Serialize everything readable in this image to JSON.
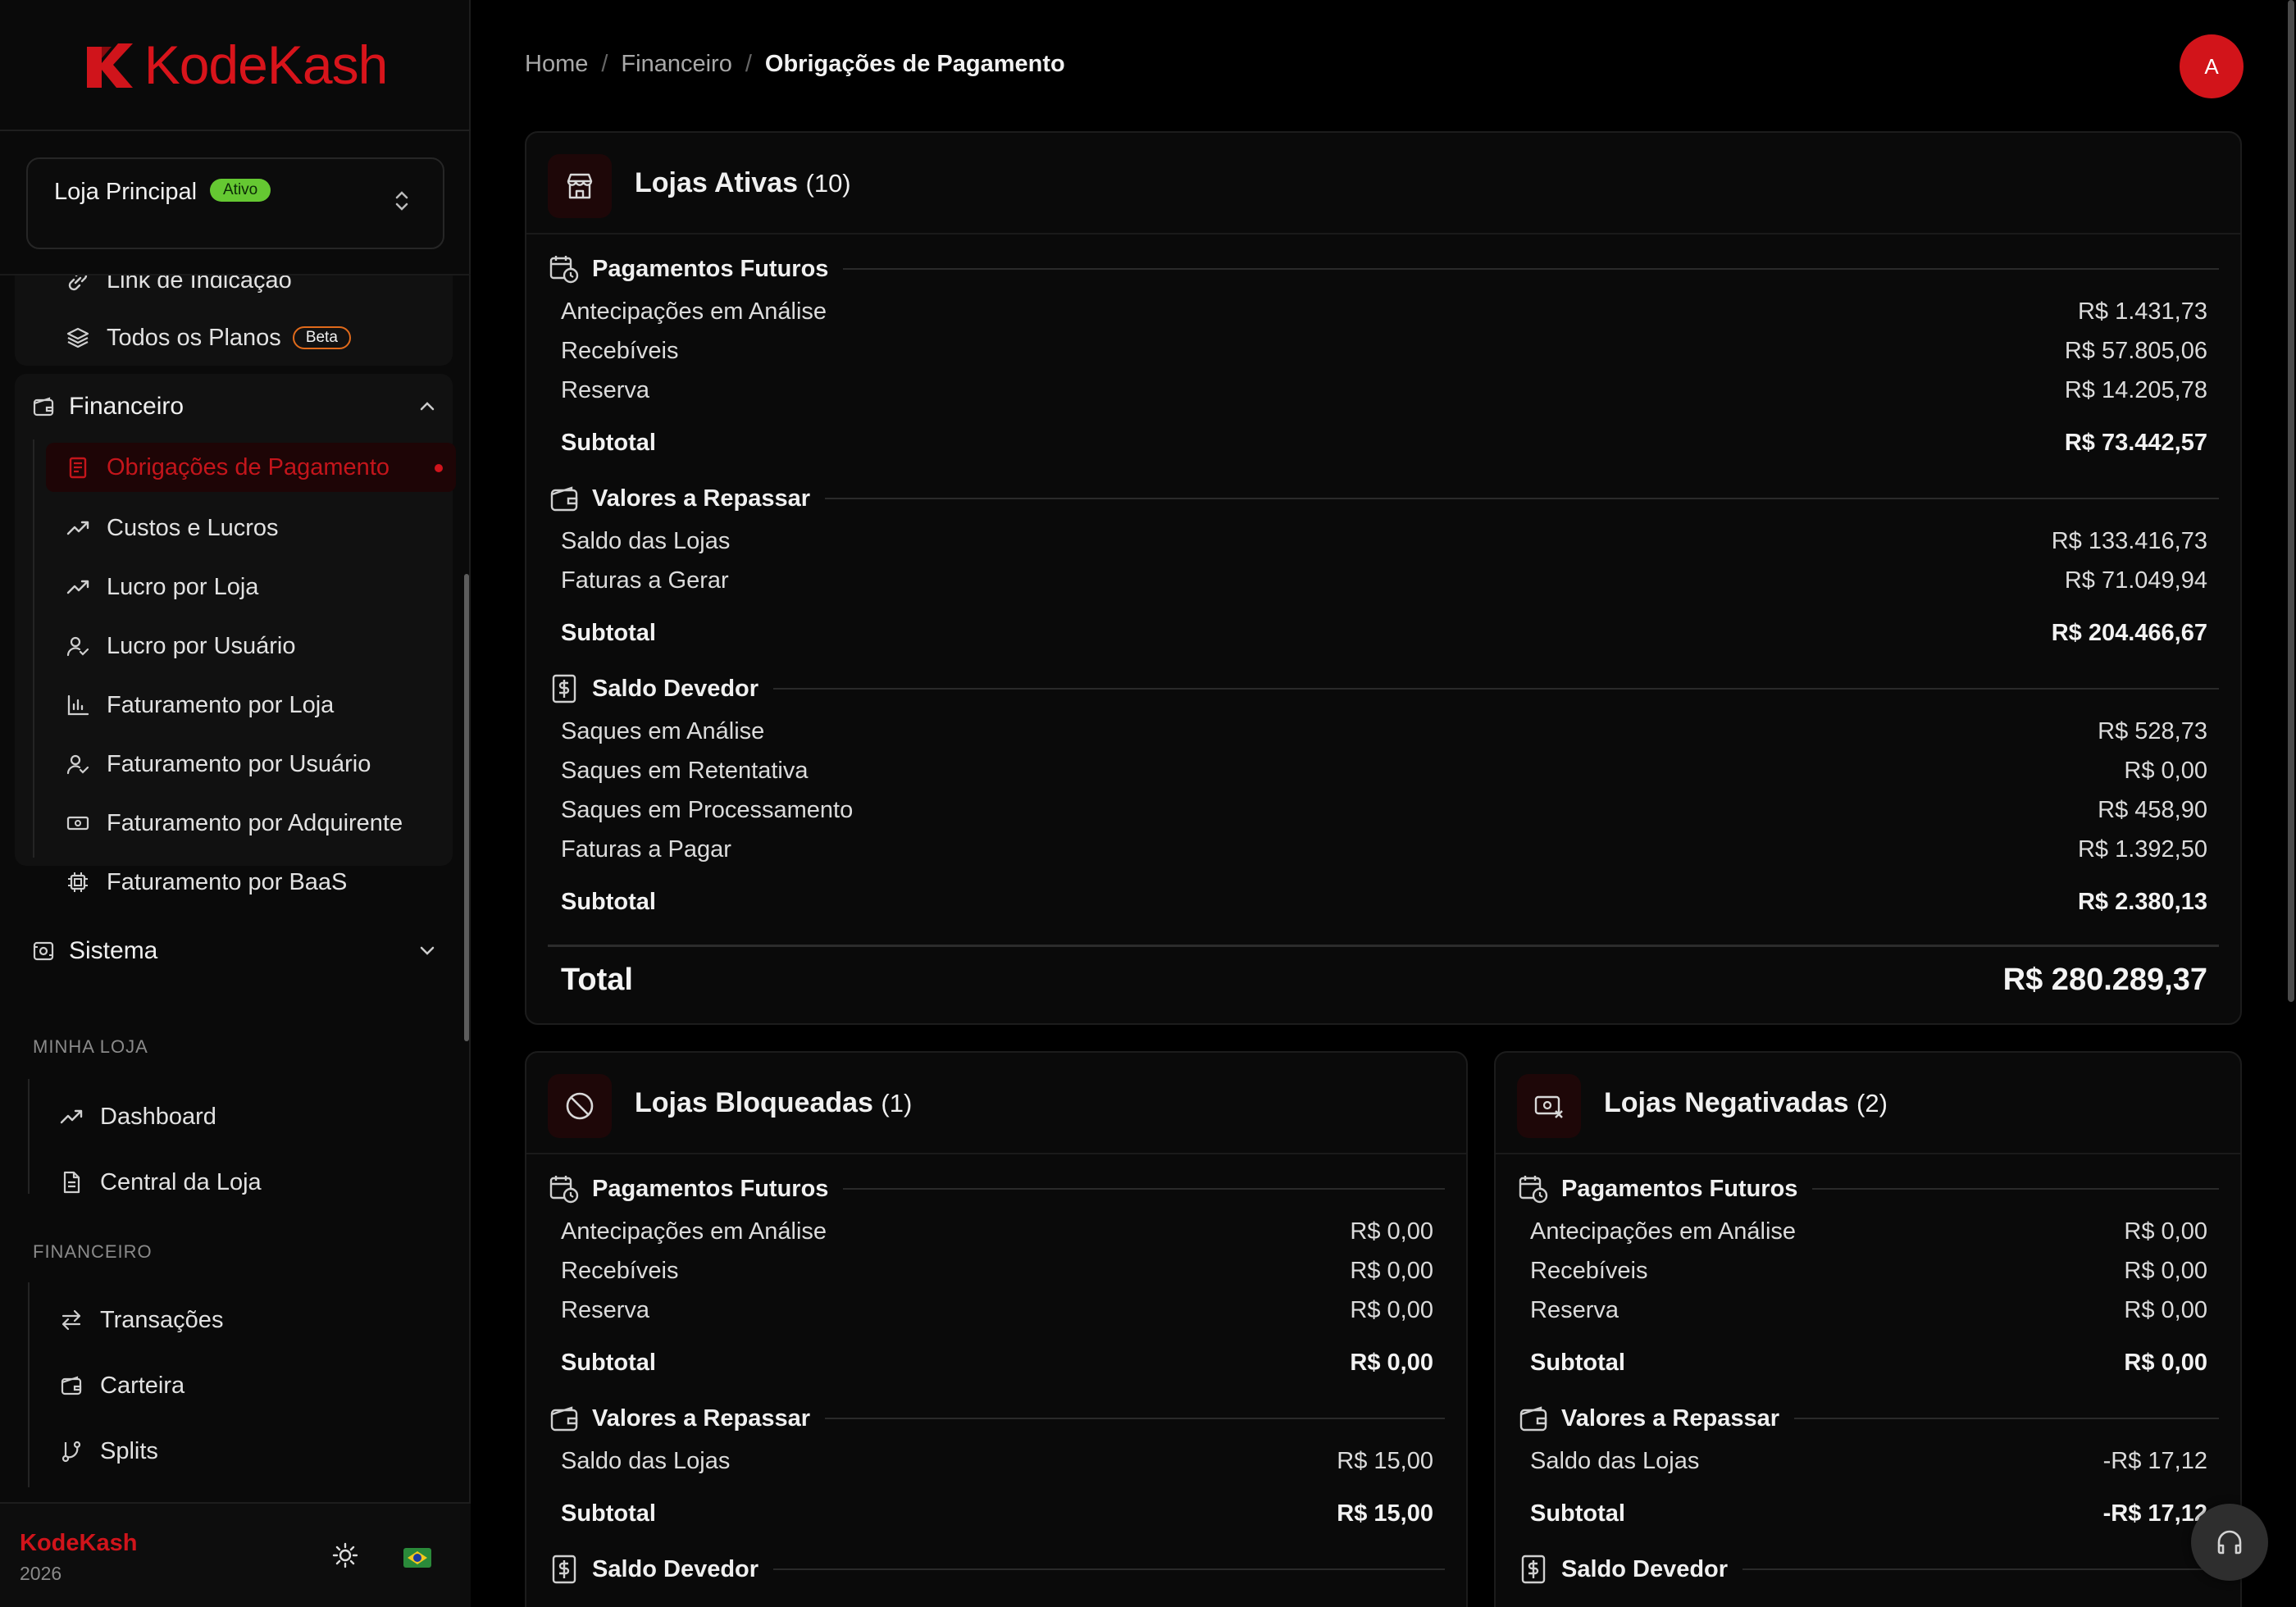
{
  "brand": {
    "name": "KodeKash",
    "year": "2026"
  },
  "store": {
    "name": "Loja Principal",
    "status": "Ativo"
  },
  "sidebar": {
    "top_items": [
      {
        "label": "Link de Indicação"
      },
      {
        "label": "Todos os Planos",
        "badge": "Beta"
      }
    ],
    "financeiro_group": {
      "label": "Financeiro",
      "items": [
        {
          "label": "Obrigações de Pagamento"
        },
        {
          "label": "Custos e Lucros"
        },
        {
          "label": "Lucro por Loja"
        },
        {
          "label": "Lucro por Usuário"
        },
        {
          "label": "Faturamento por Loja"
        },
        {
          "label": "Faturamento por Usuário"
        },
        {
          "label": "Faturamento por Adquirente"
        },
        {
          "label": "Faturamento por BaaS"
        }
      ]
    },
    "sistema_group": {
      "label": "Sistema"
    },
    "minha_loja": {
      "heading": "MINHA LOJA",
      "items": [
        {
          "label": "Dashboard"
        },
        {
          "label": "Central da Loja"
        }
      ]
    },
    "financeiro_section": {
      "heading": "FINANCEIRO",
      "items": [
        {
          "label": "Transações"
        },
        {
          "label": "Carteira"
        },
        {
          "label": "Splits"
        }
      ]
    }
  },
  "breadcrumb": {
    "home": "Home",
    "parent": "Financeiro",
    "current": "Obrigações de Pagamento"
  },
  "user": {
    "initial": "A"
  },
  "cards": {
    "ativas": {
      "title": "Lojas Ativas",
      "count": "(10)",
      "futuros": {
        "label": "Pagamentos Futuros",
        "rows": [
          {
            "label": "Antecipações em Análise",
            "value": "R$ 1.431,73"
          },
          {
            "label": "Recebíveis",
            "value": "R$ 57.805,06"
          },
          {
            "label": "Reserva",
            "value": "R$ 14.205,78"
          }
        ],
        "subtotal_label": "Subtotal",
        "subtotal": "R$ 73.442,57"
      },
      "repassar": {
        "label": "Valores a Repassar",
        "rows": [
          {
            "label": "Saldo das Lojas",
            "value": "R$ 133.416,73"
          },
          {
            "label": "Faturas a Gerar",
            "value": "R$ 71.049,94"
          }
        ],
        "subtotal_label": "Subtotal",
        "subtotal": "R$ 204.466,67"
      },
      "devedor": {
        "label": "Saldo Devedor",
        "rows": [
          {
            "label": "Saques em Análise",
            "value": "R$ 528,73"
          },
          {
            "label": "Saques em Retentativa",
            "value": "R$ 0,00"
          },
          {
            "label": "Saques em Processamento",
            "value": "R$ 458,90"
          },
          {
            "label": "Faturas a Pagar",
            "value": "R$ 1.392,50"
          }
        ],
        "subtotal_label": "Subtotal",
        "subtotal": "R$ 2.380,13"
      },
      "total_label": "Total",
      "total": "R$ 280.289,37"
    },
    "bloqueadas": {
      "title": "Lojas Bloqueadas",
      "count": "(1)",
      "futuros": {
        "label": "Pagamentos Futuros",
        "rows": [
          {
            "label": "Antecipações em Análise",
            "value": "R$ 0,00"
          },
          {
            "label": "Recebíveis",
            "value": "R$ 0,00"
          },
          {
            "label": "Reserva",
            "value": "R$ 0,00"
          }
        ],
        "subtotal_label": "Subtotal",
        "subtotal": "R$ 0,00"
      },
      "repassar": {
        "label": "Valores a Repassar",
        "rows": [
          {
            "label": "Saldo das Lojas",
            "value": "R$ 15,00"
          }
        ],
        "subtotal_label": "Subtotal",
        "subtotal": "R$ 15,00"
      },
      "devedor": {
        "label": "Saldo Devedor"
      }
    },
    "negativadas": {
      "title": "Lojas Negativadas",
      "count": "(2)",
      "futuros": {
        "label": "Pagamentos Futuros",
        "rows": [
          {
            "label": "Antecipações em Análise",
            "value": "R$ 0,00"
          },
          {
            "label": "Recebíveis",
            "value": "R$ 0,00"
          },
          {
            "label": "Reserva",
            "value": "R$ 0,00"
          }
        ],
        "subtotal_label": "Subtotal",
        "subtotal": "R$ 0,00"
      },
      "repassar": {
        "label": "Valores a Repassar",
        "rows": [
          {
            "label": "Saldo das Lojas",
            "value": "-R$ 17,12"
          }
        ],
        "subtotal_label": "Subtotal",
        "subtotal": "-R$ 17,12"
      },
      "devedor": {
        "label": "Saldo Devedor"
      }
    }
  },
  "colors": {
    "accent": "#d0141b",
    "badge_active": "#65c832",
    "badge_beta_border": "#e06a1b"
  }
}
